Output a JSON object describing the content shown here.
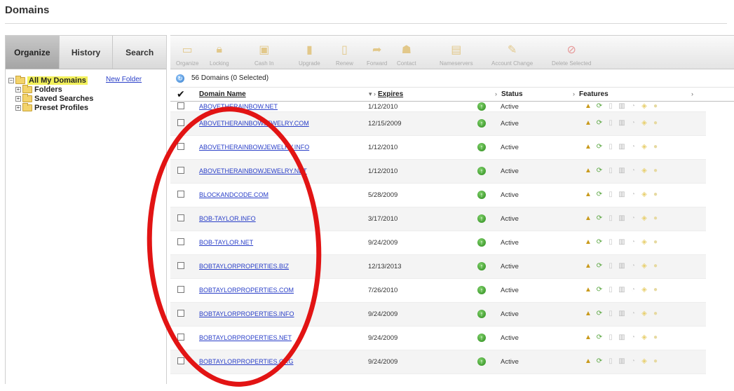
{
  "page": {
    "title": "Domains"
  },
  "left_panel": {
    "tabs": [
      {
        "label": "Organize",
        "active": true
      },
      {
        "label": "History",
        "active": false
      },
      {
        "label": "Search",
        "active": false
      }
    ],
    "tree": {
      "root": "All My Domains",
      "new_folder": "New Folder",
      "children": [
        "Folders",
        "Saved Searches",
        "Preset Profiles"
      ]
    }
  },
  "toolbar": {
    "buttons": [
      {
        "label": "Organize",
        "icon": "folder-icon"
      },
      {
        "label": "Locking",
        "icon": "lock-icon"
      },
      {
        "label": "Cash In",
        "icon": "cash-icon"
      },
      {
        "label": "Upgrade",
        "icon": "upgrade-icon"
      },
      {
        "label": "Renew",
        "icon": "renew-icon"
      },
      {
        "label": "Forward",
        "icon": "forward-icon"
      },
      {
        "label": "Contact",
        "icon": "contact-icon"
      },
      {
        "label": "Nameservers",
        "icon": "nameservers-icon"
      },
      {
        "label": "Account Change",
        "icon": "account-change-icon"
      },
      {
        "label": "Delete Selected",
        "icon": "delete-icon"
      }
    ]
  },
  "grid": {
    "summary": "56 Domains (0 Selected)",
    "columns": {
      "domain": "Domain Name",
      "expires": "Expires",
      "status": "Status",
      "features": "Features"
    },
    "rows": [
      {
        "domain": "ABOVETHERAINBOW.NET",
        "expires": "1/12/2010",
        "status": "Active"
      },
      {
        "domain": "ABOVETHERAINBOWJEWELRY.COM",
        "expires": "12/15/2009",
        "status": "Active"
      },
      {
        "domain": "ABOVETHERAINBOWJEWELRY.INFO",
        "expires": "1/12/2010",
        "status": "Active"
      },
      {
        "domain": "ABOVETHERAINBOWJEWELRY.NET",
        "expires": "1/12/2010",
        "status": "Active"
      },
      {
        "domain": "BLOCKANDCODE.COM",
        "expires": "5/28/2009",
        "status": "Active"
      },
      {
        "domain": "BOB-TAYLOR.INFO",
        "expires": "3/17/2010",
        "status": "Active"
      },
      {
        "domain": "BOB-TAYLOR.NET",
        "expires": "9/24/2009",
        "status": "Active"
      },
      {
        "domain": "BOBTAYLORPROPERTIES.BIZ",
        "expires": "12/13/2013",
        "status": "Active"
      },
      {
        "domain": "BOBTAYLORPROPERTIES.COM",
        "expires": "7/26/2010",
        "status": "Active"
      },
      {
        "domain": "BOBTAYLORPROPERTIES.INFO",
        "expires": "9/24/2009",
        "status": "Active"
      },
      {
        "domain": "BOBTAYLORPROPERTIES.NET",
        "expires": "9/24/2009",
        "status": "Active"
      },
      {
        "domain": "BOBTAYLORPROPERTIES.ORG",
        "expires": "9/24/2009",
        "status": "Active"
      }
    ]
  },
  "colors": {
    "link": "#2a3fc8",
    "annotation": "#e21414",
    "tree_highlight": "#f2f05a",
    "status_ok": "#3c9a28"
  }
}
